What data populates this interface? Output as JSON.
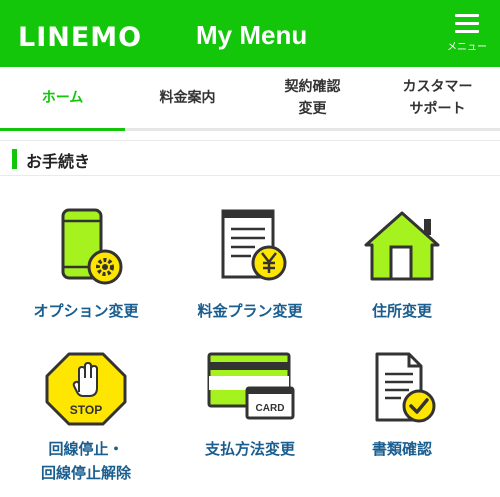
{
  "header": {
    "logo": "LINEMO",
    "title": "My Menu",
    "menu_label": "メニュー",
    "bg_color": "#13c60a"
  },
  "tabs": [
    {
      "line1": "ホーム",
      "line2": "",
      "active": true
    },
    {
      "line1": "料金案内",
      "line2": "",
      "active": false
    },
    {
      "line1": "契約確認",
      "line2": "変更",
      "active": false
    },
    {
      "line1": "カスタマー",
      "line2": "サポート",
      "active": false
    }
  ],
  "section": {
    "title": "お手続き"
  },
  "procedures": [
    {
      "label_line1": "オプション変更",
      "label_line2": "",
      "icon": "smartphone-gear-icon"
    },
    {
      "label_line1": "料金プラン変更",
      "label_line2": "",
      "icon": "bill-yen-icon"
    },
    {
      "label_line1": "住所変更",
      "label_line2": "",
      "icon": "house-icon"
    },
    {
      "label_line1": "回線停止・",
      "label_line2": "回線停止解除",
      "icon": "stop-sign-icon",
      "icon_text": "STOP"
    },
    {
      "label_line1": "支払方法変更",
      "label_line2": "",
      "icon": "credit-card-icon",
      "icon_text": "CARD"
    },
    {
      "label_line1": "書類確認",
      "label_line2": "",
      "icon": "document-check-icon"
    }
  ],
  "colors": {
    "accent": "#13c60a",
    "icon_green": "#a6f21f",
    "icon_yellow": "#ffe600",
    "link_blue": "#1a5d8f"
  }
}
